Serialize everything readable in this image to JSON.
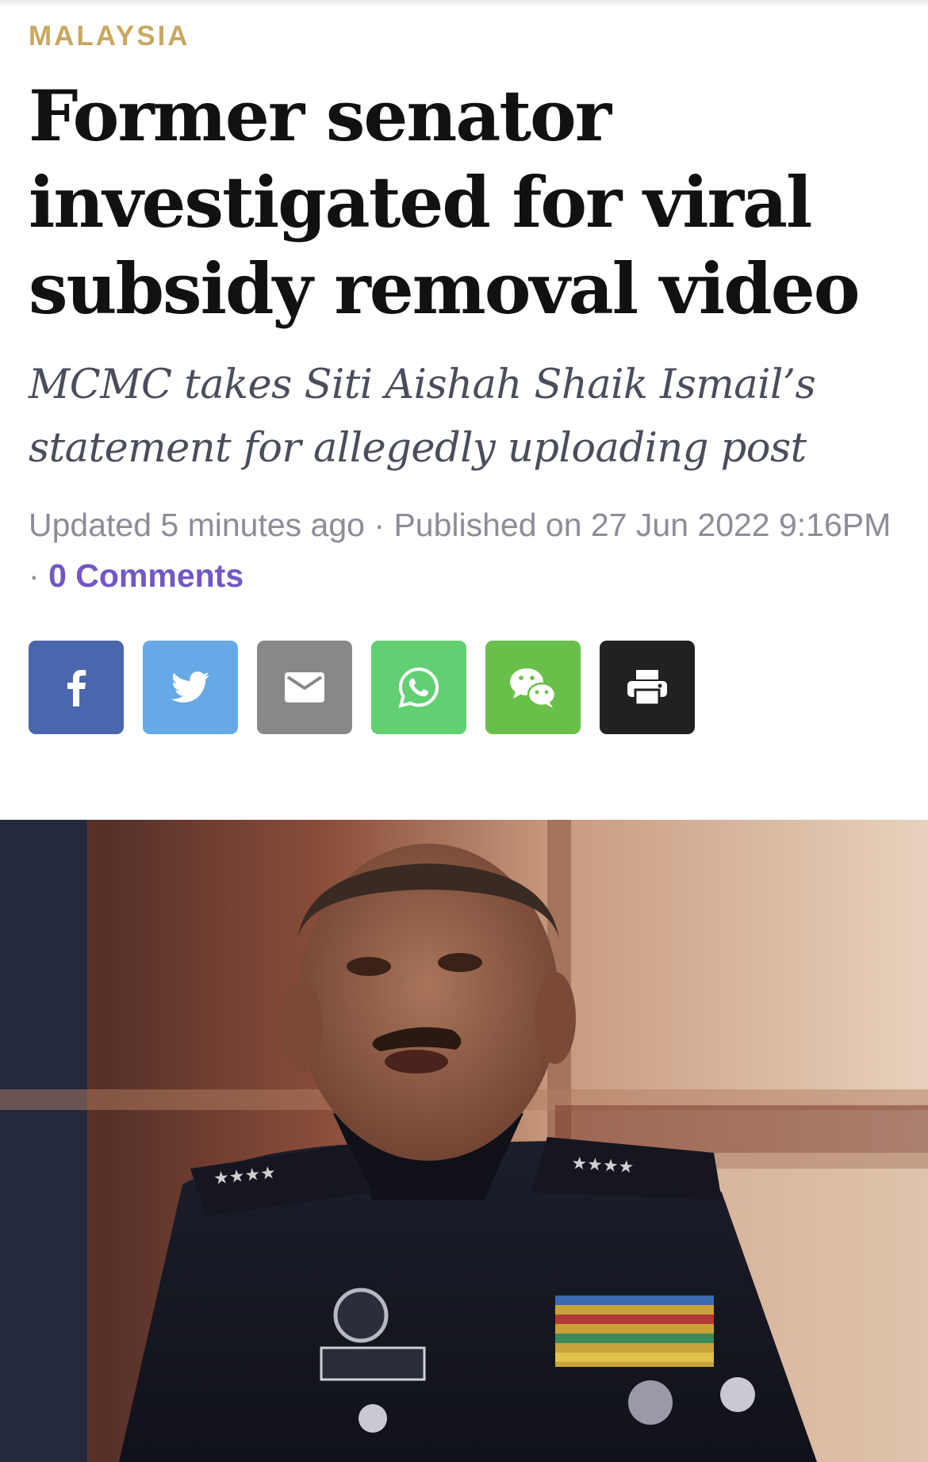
{
  "article": {
    "category": "MALAYSIA",
    "headline": "Former senator investigated for viral subsidy removal video",
    "standfirst": "MCMC takes Siti Aishah Shaik Ismail’s statement for allegedly uploading post",
    "meta": {
      "updated": "Updated 5 minutes ago",
      "separator": "·",
      "published": "Published on 27 Jun 2022 9:16PM",
      "comments": "0 Comments"
    }
  },
  "share_buttons": [
    {
      "name": "facebook",
      "icon": "facebook-icon",
      "color": "#4a67ad"
    },
    {
      "name": "twitter",
      "icon": "twitter-icon",
      "color": "#66a9e6"
    },
    {
      "name": "email",
      "icon": "mail-icon",
      "color": "#888888"
    },
    {
      "name": "whatsapp",
      "icon": "whatsapp-icon",
      "color": "#62cf73"
    },
    {
      "name": "wechat",
      "icon": "wechat-icon",
      "color": "#6abf4b"
    },
    {
      "name": "print",
      "icon": "print-icon",
      "color": "#212121"
    }
  ],
  "colors": {
    "category": "#c9a860",
    "headline": "#111111",
    "standfirst": "#4a4d5c",
    "meta": "#8b8d99",
    "link": "#7357c4"
  }
}
